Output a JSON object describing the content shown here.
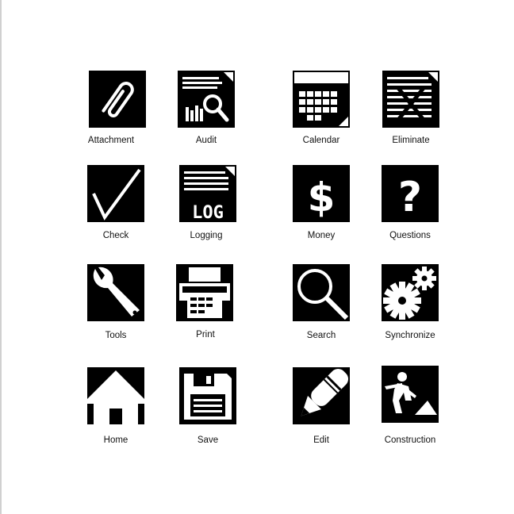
{
  "icons": [
    {
      "label": "Attachment",
      "icon": "paperclip-icon"
    },
    {
      "label": "Audit",
      "icon": "audit-magnifier-chart-icon"
    },
    {
      "label": "Calendar",
      "icon": "calendar-icon"
    },
    {
      "label": "Eliminate",
      "icon": "eliminate-document-icon"
    },
    {
      "label": "Check",
      "icon": "checkmark-icon"
    },
    {
      "label": "Logging",
      "icon": "log-document-icon"
    },
    {
      "label": "Money",
      "icon": "dollar-sign-icon"
    },
    {
      "label": "Questions",
      "icon": "question-mark-icon"
    },
    {
      "label": "Tools",
      "icon": "wrench-icon"
    },
    {
      "label": "Print",
      "icon": "printer-icon"
    },
    {
      "label": "Search",
      "icon": "magnifying-glass-icon"
    },
    {
      "label": "Synchronize",
      "icon": "gears-icon"
    },
    {
      "label": "Home",
      "icon": "house-icon"
    },
    {
      "label": "Save",
      "icon": "floppy-disk-icon"
    },
    {
      "label": "Edit",
      "icon": "pencil-icon"
    },
    {
      "label": "Construction",
      "icon": "construction-worker-icon"
    }
  ],
  "log_text": "LOG",
  "colors": {
    "tile": "#000000",
    "glyph": "#ffffff",
    "background": "#ffffff"
  }
}
